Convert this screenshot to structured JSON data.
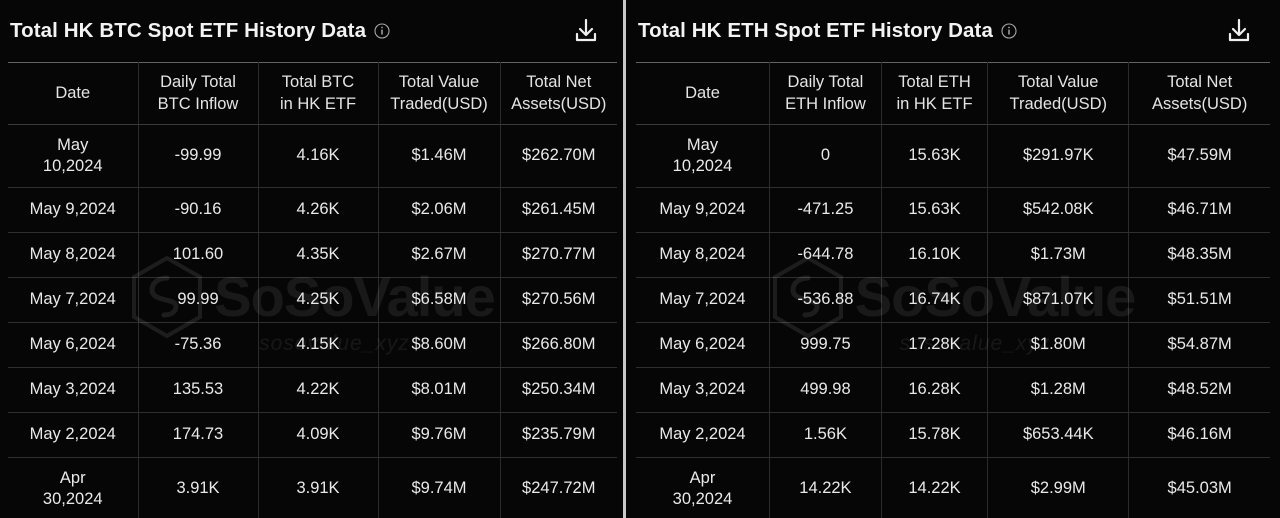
{
  "watermark": {
    "brand": "SoSoValue",
    "domain": "sosovalue_xyz",
    "logo_icon": "hexagon-logo-icon"
  },
  "colors": {
    "background": "#050505",
    "positive": "#17c964",
    "negative": "#f0453c",
    "text": "#e9e9e9",
    "divider": "#c9c9c9",
    "grid": "#2f2f2f"
  },
  "panels": [
    {
      "id": "btc",
      "title": "Total HK BTC Spot ETF History Data",
      "info_icon": "info-circle-icon",
      "download_icon": "download-icon",
      "columns": [
        "Date",
        "Daily Total BTC Inflow",
        "Total BTC in HK ETF",
        "Total Value Traded(USD)",
        "Total Net Assets(USD)"
      ],
      "columns_lines": [
        [
          "Date"
        ],
        [
          "Daily Total",
          "BTC Inflow"
        ],
        [
          "Total BTC",
          "in HK ETF"
        ],
        [
          "Total Value",
          "Traded(USD)"
        ],
        [
          "Total Net",
          "Assets(USD)"
        ]
      ],
      "rows": [
        {
          "date": "May 10,2024",
          "date_lines": [
            "May",
            "10,2024"
          ],
          "two_line": true,
          "inflow": "-99.99",
          "inflow_sign": "neg",
          "total": "4.16K",
          "traded": "$1.46M",
          "net_assets": "$262.70M"
        },
        {
          "date": "May 9,2024",
          "date_lines": [
            "May 9,2024"
          ],
          "two_line": false,
          "inflow": "-90.16",
          "inflow_sign": "neg",
          "total": "4.26K",
          "traded": "$2.06M",
          "net_assets": "$261.45M"
        },
        {
          "date": "May 8,2024",
          "date_lines": [
            "May 8,2024"
          ],
          "two_line": false,
          "inflow": "101.60",
          "inflow_sign": "pos",
          "total": "4.35K",
          "traded": "$2.67M",
          "net_assets": "$270.77M"
        },
        {
          "date": "May 7,2024",
          "date_lines": [
            "May 7,2024"
          ],
          "two_line": false,
          "inflow": "99.99",
          "inflow_sign": "pos",
          "total": "4.25K",
          "traded": "$6.58M",
          "net_assets": "$270.56M"
        },
        {
          "date": "May 6,2024",
          "date_lines": [
            "May 6,2024"
          ],
          "two_line": false,
          "inflow": "-75.36",
          "inflow_sign": "neg",
          "total": "4.15K",
          "traded": "$8.60M",
          "net_assets": "$266.80M"
        },
        {
          "date": "May 3,2024",
          "date_lines": [
            "May 3,2024"
          ],
          "two_line": false,
          "inflow": "135.53",
          "inflow_sign": "pos",
          "total": "4.22K",
          "traded": "$8.01M",
          "net_assets": "$250.34M"
        },
        {
          "date": "May 2,2024",
          "date_lines": [
            "May 2,2024"
          ],
          "two_line": false,
          "inflow": "174.73",
          "inflow_sign": "pos",
          "total": "4.09K",
          "traded": "$9.76M",
          "net_assets": "$235.79M"
        },
        {
          "date": "Apr 30,2024",
          "date_lines": [
            "Apr",
            "30,2024"
          ],
          "two_line": true,
          "inflow": "3.91K",
          "inflow_sign": "pos",
          "total": "3.91K",
          "traded": "$9.74M",
          "net_assets": "$247.72M"
        }
      ]
    },
    {
      "id": "eth",
      "title": "Total HK ETH Spot ETF History Data",
      "info_icon": "info-circle-icon",
      "download_icon": "download-icon",
      "columns": [
        "Date",
        "Daily Total ETH Inflow",
        "Total ETH in HK ETF",
        "Total Value Traded(USD)",
        "Total Net Assets(USD)"
      ],
      "columns_lines": [
        [
          "Date"
        ],
        [
          "Daily Total",
          "ETH Inflow"
        ],
        [
          "Total ETH",
          "in HK ETF"
        ],
        [
          "Total Value",
          "Traded(USD)"
        ],
        [
          "Total Net",
          "Assets(USD)"
        ]
      ],
      "rows": [
        {
          "date": "May 10,2024",
          "date_lines": [
            "May",
            "10,2024"
          ],
          "two_line": true,
          "inflow": "0",
          "inflow_sign": "zero",
          "total": "15.63K",
          "traded": "$291.97K",
          "net_assets": "$47.59M"
        },
        {
          "date": "May 9,2024",
          "date_lines": [
            "May 9,2024"
          ],
          "two_line": false,
          "inflow": "-471.25",
          "inflow_sign": "neg",
          "total": "15.63K",
          "traded": "$542.08K",
          "net_assets": "$46.71M"
        },
        {
          "date": "May 8,2024",
          "date_lines": [
            "May 8,2024"
          ],
          "two_line": false,
          "inflow": "-644.78",
          "inflow_sign": "neg",
          "total": "16.10K",
          "traded": "$1.73M",
          "net_assets": "$48.35M"
        },
        {
          "date": "May 7,2024",
          "date_lines": [
            "May 7,2024"
          ],
          "two_line": false,
          "inflow": "-536.88",
          "inflow_sign": "neg",
          "total": "16.74K",
          "traded": "$871.07K",
          "net_assets": "$51.51M"
        },
        {
          "date": "May 6,2024",
          "date_lines": [
            "May 6,2024"
          ],
          "two_line": false,
          "inflow": "999.75",
          "inflow_sign": "pos",
          "total": "17.28K",
          "traded": "$1.80M",
          "net_assets": "$54.87M"
        },
        {
          "date": "May 3,2024",
          "date_lines": [
            "May 3,2024"
          ],
          "two_line": false,
          "inflow": "499.98",
          "inflow_sign": "pos",
          "total": "16.28K",
          "traded": "$1.28M",
          "net_assets": "$48.52M"
        },
        {
          "date": "May 2,2024",
          "date_lines": [
            "May 2,2024"
          ],
          "two_line": false,
          "inflow": "1.56K",
          "inflow_sign": "pos",
          "total": "15.78K",
          "traded": "$653.44K",
          "net_assets": "$46.16M"
        },
        {
          "date": "Apr 30,2024",
          "date_lines": [
            "Apr",
            "30,2024"
          ],
          "two_line": true,
          "inflow": "14.22K",
          "inflow_sign": "pos",
          "total": "14.22K",
          "traded": "$2.99M",
          "net_assets": "$45.03M"
        }
      ]
    }
  ]
}
